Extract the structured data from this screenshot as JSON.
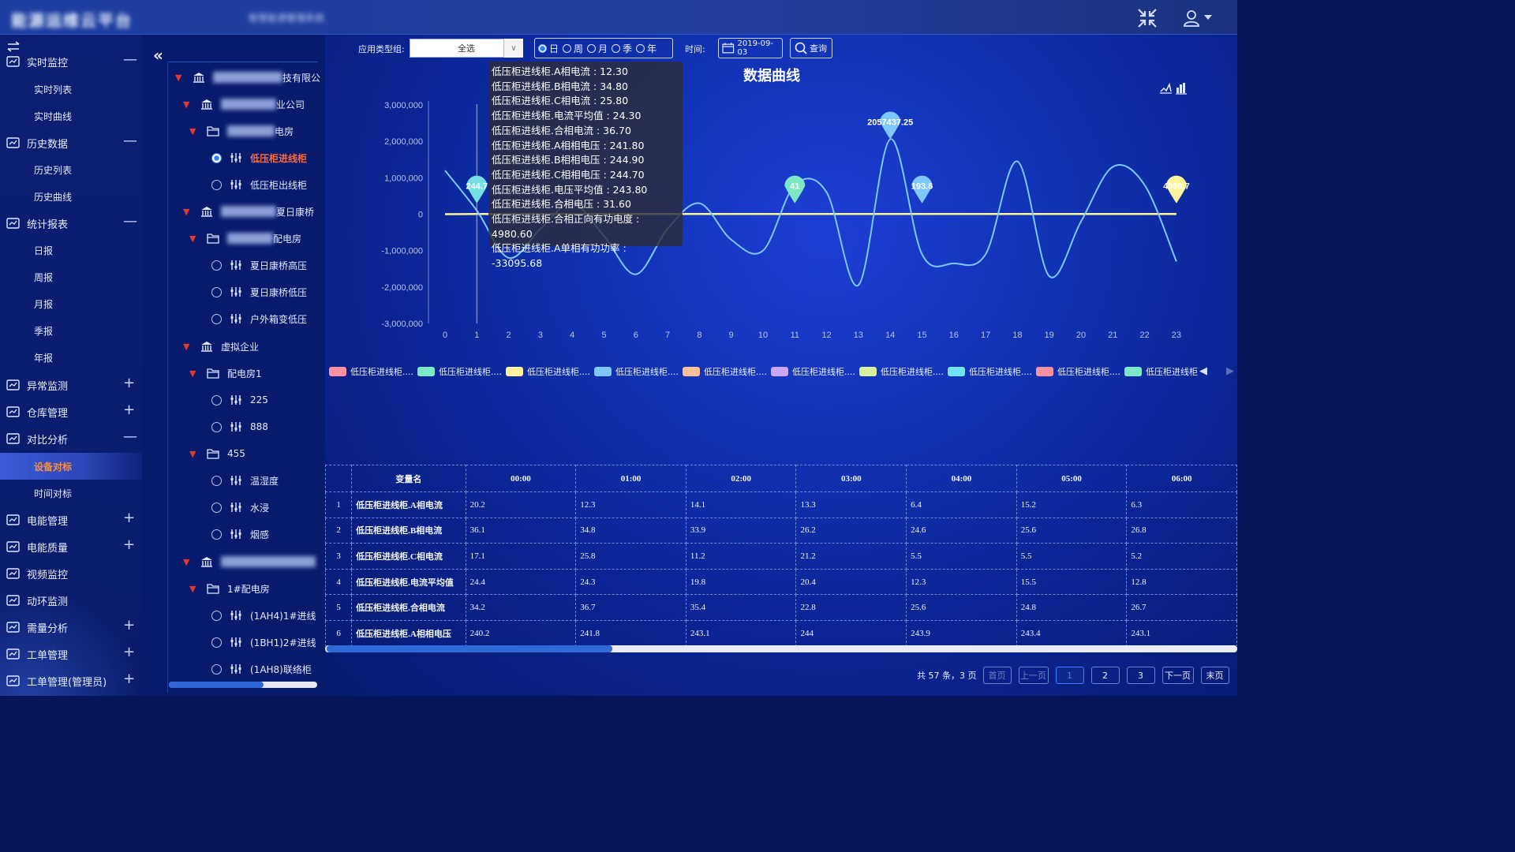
{
  "header": {
    "title": "能源运维云平台",
    "subtitle": "智慧能源管理系统"
  },
  "nav": {
    "groups": [
      {
        "label": "实时监控",
        "toggle": "—",
        "icon": "monitor-icon"
      },
      {
        "label": "历史数据",
        "toggle": "—",
        "icon": "history-icon"
      },
      {
        "label": "统计报表",
        "toggle": "—",
        "icon": "report-icon"
      },
      {
        "label": "异常监测",
        "toggle": "+",
        "icon": "alert-icon"
      },
      {
        "label": "仓库管理",
        "toggle": "+",
        "icon": "warehouse-icon"
      },
      {
        "label": "对比分析",
        "toggle": "—",
        "icon": "compare-icon"
      },
      {
        "label": "电能管理",
        "toggle": "+",
        "icon": "power-icon"
      },
      {
        "label": "电能质量",
        "toggle": "+",
        "icon": "quality-icon"
      },
      {
        "label": "视频监控",
        "toggle": "",
        "icon": "camera-icon"
      },
      {
        "label": "动环监测",
        "toggle": "",
        "icon": "env-icon"
      },
      {
        "label": "需量分析",
        "toggle": "+",
        "icon": "demand-icon"
      },
      {
        "label": "工单管理",
        "toggle": "+",
        "icon": "ticket-icon"
      },
      {
        "label": "工单管理(管理员)",
        "toggle": "+",
        "icon": "ticket-admin-icon"
      }
    ],
    "subs": {
      "realtime": [
        "实时列表",
        "实时曲线"
      ],
      "history": [
        "历史列表",
        "历史曲线"
      ],
      "report": [
        "日报",
        "周报",
        "月报",
        "季报",
        "年报"
      ],
      "compare": [
        "设备对标",
        "时间对标"
      ]
    }
  },
  "tree": {
    "nodes": [
      "技有限公",
      "业公司",
      "电房",
      "低压柜进线柜",
      "低压柜出线柜",
      "夏日康桥",
      "配电房",
      "夏日康桥高压",
      "夏日康桥低压",
      "户外箱变低压",
      "虚拟企业",
      "配电房1",
      "225",
      "888",
      "455",
      "温湿度",
      "水浸",
      "烟感",
      "",
      "1#配电房",
      "(1AH4)1#进线",
      "(1BH1)2#进线",
      "(1AH8)联络柜"
    ]
  },
  "filters": {
    "type_label": "应用类型组:",
    "type_value": "全选",
    "periods": [
      "日",
      "周",
      "月",
      "季",
      "年"
    ],
    "period_selected": "日",
    "time_label": "时间:",
    "date": "2019-09-03",
    "query": "查询"
  },
  "tooltip": {
    "lines": [
      "低压柜进线柜.A相电流 : 12.30",
      "低压柜进线柜.B相电流 : 34.80",
      "低压柜进线柜.C相电流 : 25.80",
      "低压柜进线柜.电流平均值 : 24.30",
      "低压柜进线柜.合相电流 : 36.70",
      "低压柜进线柜.A相相电压 : 241.80",
      "低压柜进线柜.B相相电压 : 244.90",
      "低压柜进线柜.C相相电压 : 244.70",
      "低压柜进线柜.电压平均值 : 243.80",
      "低压柜进线柜.合相电压 : 31.60",
      "低压柜进线柜.合相正向有功电度 : 4980.60",
      "低压柜进线柜.A单相有功功率 : -33095.68"
    ]
  },
  "chart_data": {
    "type": "line",
    "title": "数据曲线",
    "x": [
      "0",
      "1",
      "2",
      "3",
      "4",
      "5",
      "6",
      "7",
      "8",
      "9",
      "10",
      "11",
      "12",
      "13",
      "14",
      "15",
      "16",
      "17",
      "18",
      "19",
      "20",
      "21",
      "22",
      "23"
    ],
    "ylim": [
      -3000000,
      3000000
    ],
    "yticks": [
      "3,000,000",
      "2,000,000",
      "1,000,000",
      "0",
      "-1,000,000",
      "-2,000,000",
      "-3,000,000"
    ],
    "series": [
      {
        "name": "低压柜进线柜.A单相有功功率",
        "color": "#7ec8ff",
        "values": [
          1200000,
          100000,
          -1200000,
          -400000,
          300000,
          -600000,
          -1650000,
          -400000,
          300000,
          -700000,
          -1000000,
          800000,
          600000,
          -1950000,
          2057437.25,
          -1100000,
          -1350000,
          -1100000,
          1450000,
          -1700000,
          -200000,
          1300000,
          800000,
          -1300000
        ]
      },
      {
        "name": "低压柜进线柜.合相正向有功电度",
        "color": "#fff59d",
        "values": [
          0,
          4980.6,
          4980.6,
          4980.6,
          4980.6,
          4980.6,
          4980.6,
          4980.6,
          4980.6,
          4980.6,
          4980.6,
          4980.6,
          4980.6,
          4980.6,
          4980.6,
          4980.6,
          4980.6,
          4980.6,
          4980.6,
          4980.6,
          4980.6,
          4980.6,
          4980.6,
          4980.6
        ]
      }
    ],
    "markers": [
      {
        "x": "1",
        "label": "244.7",
        "color": "#73e0e6"
      },
      {
        "x": "11",
        "label": "41",
        "color": "#7de8c6"
      },
      {
        "x": "14",
        "label": "2057437.25",
        "color": "#7ec8ff"
      },
      {
        "x": "15",
        "label": "193.6",
        "color": "#7ec8ff"
      },
      {
        "x": "23",
        "label": "4980.7",
        "color": "#fff59d"
      }
    ],
    "legend": [
      {
        "label": "低压柜进线柜....",
        "color": "#ff8fa3"
      },
      {
        "label": "低压柜进线柜....",
        "color": "#7de8c6"
      },
      {
        "label": "低压柜进线柜....",
        "color": "#fff59d"
      },
      {
        "label": "低压柜进线柜....",
        "color": "#7ec8ff"
      },
      {
        "label": "低压柜进线柜....",
        "color": "#ffc19a"
      },
      {
        "label": "低压柜进线柜....",
        "color": "#c9a6f2"
      },
      {
        "label": "低压柜进线柜....",
        "color": "#d9f2a0"
      },
      {
        "label": "低压柜进线柜....",
        "color": "#6fe5f5"
      },
      {
        "label": "低压柜进线柜....",
        "color": "#ff8fa3"
      },
      {
        "label": "低压柜进线柜",
        "color": "#7de8c6"
      }
    ]
  },
  "table": {
    "headers": [
      "",
      "变量名",
      "00:00",
      "01:00",
      "02:00",
      "03:00",
      "04:00",
      "05:00",
      "06:00"
    ],
    "rows": [
      [
        "1",
        "低压柜进线柜.A相电流",
        "20.2",
        "12.3",
        "14.1",
        "13.3",
        "6.4",
        "15.2",
        "6.3"
      ],
      [
        "2",
        "低压柜进线柜.B相电流",
        "36.1",
        "34.8",
        "33.9",
        "26.2",
        "24.6",
        "25.6",
        "26.8"
      ],
      [
        "3",
        "低压柜进线柜.C相电流",
        "17.1",
        "25.8",
        "11.2",
        "21.2",
        "5.5",
        "5.5",
        "5.2"
      ],
      [
        "4",
        "低压柜进线柜.电流平均值",
        "24.4",
        "24.3",
        "19.8",
        "20.4",
        "12.3",
        "15.5",
        "12.8"
      ],
      [
        "5",
        "低压柜进线柜.合相电流",
        "34.2",
        "36.7",
        "35.4",
        "22.8",
        "25.6",
        "24.8",
        "26.7"
      ],
      [
        "6",
        "低压柜进线柜.A相相电压",
        "240.2",
        "241.8",
        "243.1",
        "244",
        "243.9",
        "243.4",
        "243.1"
      ]
    ]
  },
  "pager": {
    "total": "共 57 条，3 页",
    "first": "首页",
    "prev": "上一页",
    "pages": [
      "1",
      "2",
      "3"
    ],
    "next": "下一页",
    "last": "末页"
  }
}
